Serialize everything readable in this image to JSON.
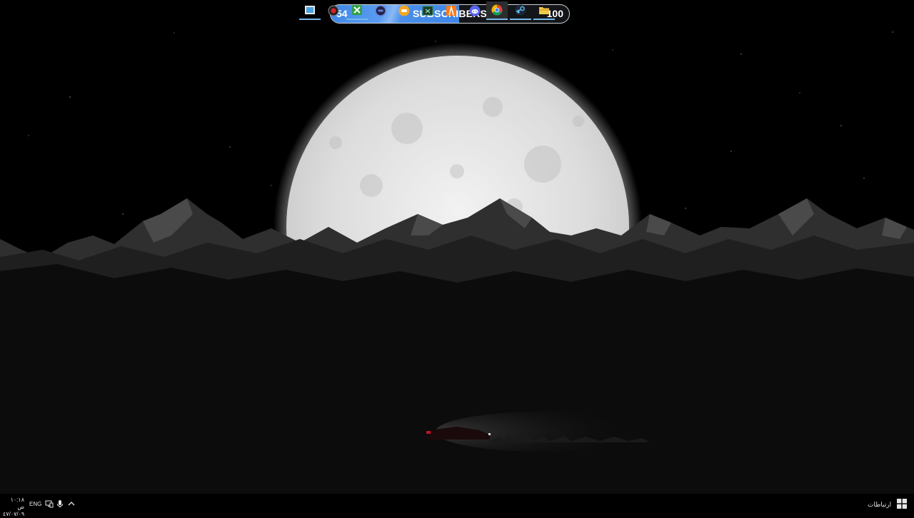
{
  "subscriber_widget": {
    "current": "54",
    "label": "SUBSCRIBERS",
    "goal": "100",
    "progress_fraction": 0.54,
    "fill_color": "#3f86e8"
  },
  "wallpaper": {
    "moon_color": "#e9e9e9",
    "mountain_color": "#3a3a3a",
    "car_taillight_color": "#c0122b"
  },
  "taskbar": {
    "tray": {
      "clock_time": "١٠:١٨ ص",
      "clock_date": "٤٧/٠٧/٠٩",
      "language": "ENG",
      "icons": [
        "network-icon",
        "microphone-icon",
        "chevron-up-icon"
      ]
    },
    "apps": [
      {
        "name": "app-store-icon",
        "color": "#4aa3df"
      },
      {
        "name": "recorder-icon",
        "color": "#d8232a"
      },
      {
        "name": "xbox-icon",
        "color": "#2ea043"
      },
      {
        "name": "widget-icon",
        "color": "#6a7bd8"
      },
      {
        "name": "chat-icon",
        "color": "#f5a623"
      },
      {
        "name": "terminal-icon",
        "color": "#2e8b57"
      },
      {
        "name": "flstudio-icon",
        "color": "#ff7a1a"
      },
      {
        "name": "discord-icon",
        "color": "#5865f2"
      },
      {
        "name": "chrome-icon",
        "color": "#f4b400"
      },
      {
        "name": "steam-icon",
        "color": "#1b6fb2"
      },
      {
        "name": "file-explorer-icon",
        "color": "#f2c94c"
      }
    ],
    "links_label": "ارتباطات"
  }
}
